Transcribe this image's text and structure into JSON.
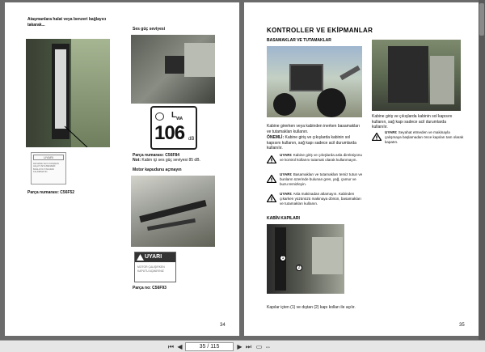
{
  "left_page": {
    "caption_top": "Ataşmanlara halat veya benzeri bağlayıcı takarak...",
    "sticker_title": "UYARI",
    "sticker_text": "DE MANE VEYA ATAŞMAN HALAT VEYA BENZERİ BAĞLAYICI TAKARAK KALDIRMAYIN",
    "part_1": "Parça numarası: C56F52",
    "section_sound": "Ses güç seviyesi",
    "lwa_label": "L",
    "lwa_sub": "WA",
    "lwa_value": "106",
    "lwa_unit": "dB",
    "part_2": "Parça numarası: C56F84",
    "note_sound": "Not: Kabin içi ses güç seviyesi 85 dB.",
    "section_hood": "Motor kapudunu açmayın",
    "warning_label_title": "UYARI",
    "warning_label_text": "MOTOR ÇALIŞIRKEN KAPUTU AÇMAYINIZ",
    "part_3": "Parça no: C56F93",
    "page_number": "34"
  },
  "right_page": {
    "title": "KONTROLLER VE EKİPMANLAR",
    "section_steps": "BASAMAKLAR VE TUTAMAKLAR",
    "para_1": "Kabine girerken veya kabinden inerken basamakları ve tutamakları kullanın.",
    "para_important_label": "ÖNEMLİ:",
    "para_important": "Kabine giriş ve çıkışlarda kabinin sol kapısını kullanın, sağ kapı sadece acil durumlarda kullanılır.",
    "warn_1_label": "UYARI:",
    "warn_1": "Kabine giriş ve çıkışlarda asla direksiyonu ve kontrol kollarını tutamak olarak kullanmayın.",
    "warn_2_label": "UYARI:",
    "warn_2": "Basamakları ve tutamakları temiz tutun ve bunların üzerinde bulunan gres, yağ, çamur ve buzu temizleyin.",
    "warn_3_label": "UYARI:",
    "warn_3": "Asla makinadan atlamayın. Kabinden çıkarken yüzünüzü makinaya dönün, basamakları ve tutamakları kullanın.",
    "right_para": "Kabine giriş ve çıkışlarda kabinin sol kapısını kullanın, sağ kapı sadece acil durumlarda kullanılır.",
    "right_warn_label": "UYARI:",
    "right_warn": "Seyahat etmeden ve makinayla çalışmaya başlamadan önce kapıları tam olarak kapatın.",
    "section_doors": "KABİN KAPILARI",
    "callout_1": "1",
    "callout_2": "2",
    "caption_doors": "Kapılar içten (1) ve dıştan (2) kapı kolları ile açılır.",
    "page_number": "35"
  },
  "toolbar": {
    "page_indicator": "35 / 115"
  }
}
